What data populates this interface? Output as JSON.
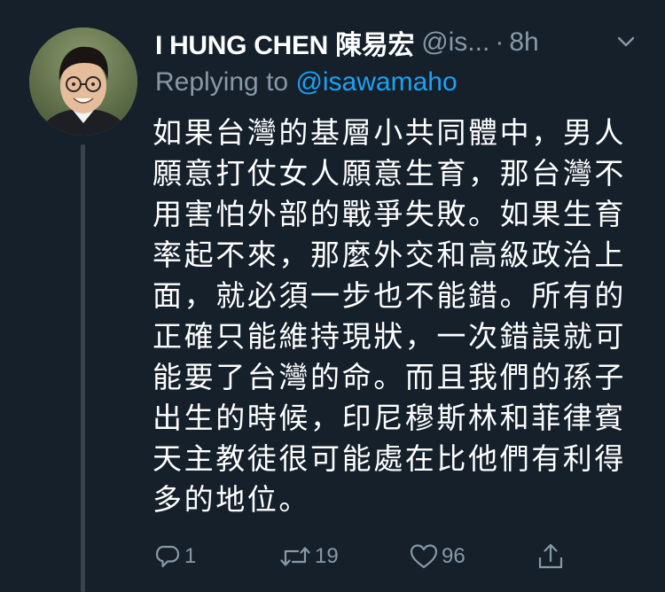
{
  "tweet": {
    "display_name": "I HUNG CHEN 陳易宏",
    "handle": "@is...",
    "separator": "·",
    "time": "8h",
    "replying_prefix": "Replying to ",
    "replying_to": "@isawamaho",
    "text": "如果台灣的基層小共同體中，男人願意打仗女人願意生育，那台灣不用害怕外部的戰爭失敗。如果生育率起不來，那麼外交和高級政治上面，就必須一步也不能錯。所有的正確只能維持現狀，一次錯誤就可能要了台灣的命。而且我們的孫子出生的時候，印尼穆斯林和菲律賓天主教徒很可能處在比他們有利得多的地位。"
  },
  "actions": {
    "reply_count": "1",
    "retweet_count": "19",
    "like_count": "96"
  },
  "icons": {
    "chevron": "chevron-down-icon",
    "reply": "reply-icon",
    "retweet": "retweet-icon",
    "like": "heart-icon",
    "share": "share-icon"
  },
  "colors": {
    "background": "#15202b",
    "secondary_text": "#8899a6",
    "link": "#1da1f2",
    "thread_line": "#38444d"
  }
}
